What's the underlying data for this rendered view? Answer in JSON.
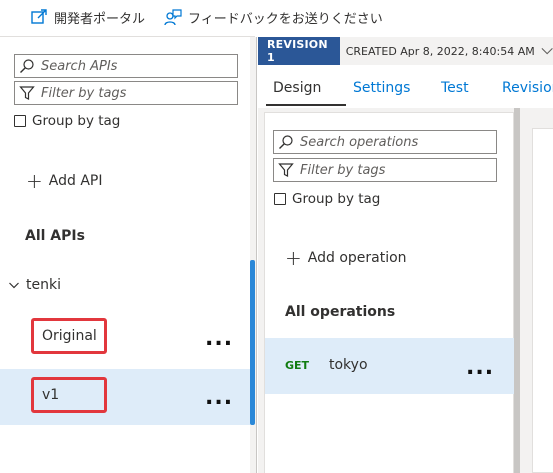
{
  "toolbar": {
    "portal_label": "開発者ポータル",
    "feedback_label": "フィードバックをお送りください"
  },
  "apis_panel": {
    "search_placeholder": "Search APIs",
    "filter_placeholder": "Filter by tags",
    "group_by_tag_label": "Group by tag",
    "add_api_label": "Add API",
    "all_apis_label": "All APIs",
    "api_group": "tenki",
    "versions": [
      {
        "label": "Original",
        "selected": false,
        "more": "..."
      },
      {
        "label": "v1",
        "selected": true,
        "more": "..."
      }
    ]
  },
  "revision": {
    "badge": "REVISION 1",
    "created": "CREATED Apr 8, 2022, 8:40:54 AM"
  },
  "tabs": [
    "Design",
    "Settings",
    "Test",
    "Revision"
  ],
  "active_tab": "Design",
  "operations_panel": {
    "search_placeholder": "Search operations",
    "filter_placeholder": "Filter by tags",
    "group_by_tag_label": "Group by tag",
    "add_operation_label": "Add operation",
    "all_operations_label": "All operations",
    "operations": [
      {
        "method": "GET",
        "name": "tokyo",
        "more": "..."
      }
    ]
  },
  "colors": {
    "accent": "#0078d4",
    "revision_badge": "#2b5797",
    "selection": "#deecf9",
    "highlight_box": "#e2373d",
    "get_method": "#107c10"
  }
}
